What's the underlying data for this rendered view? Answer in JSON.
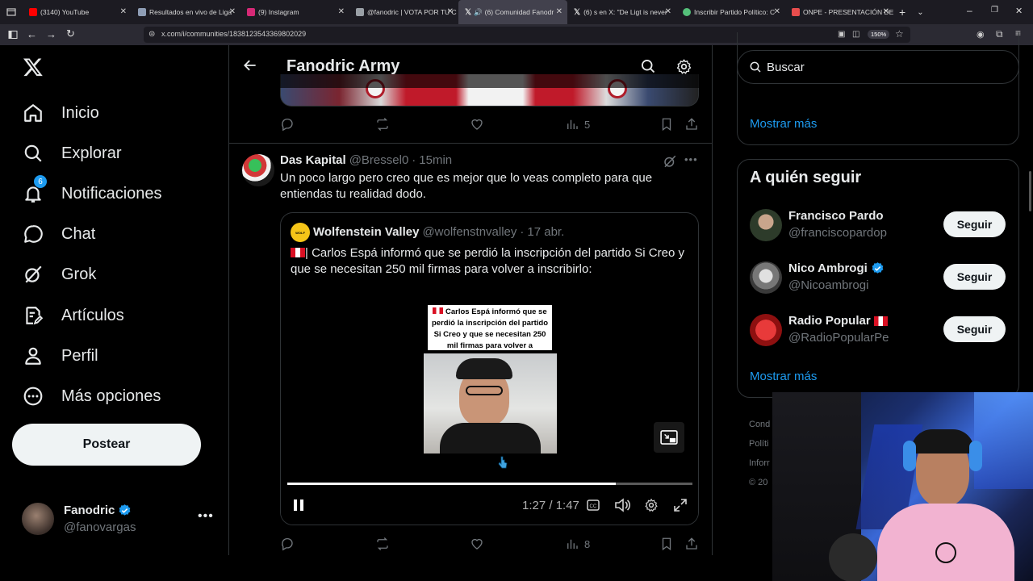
{
  "browser": {
    "tabs": [
      {
        "title": "(3140) YouTube",
        "color": "#ff0000"
      },
      {
        "title": "Resultados en vivo de Liga",
        "color": "#8e9db5"
      },
      {
        "title": "(9) Instagram",
        "color": "#d62976"
      },
      {
        "title": "@fanodric | VOTA POR TU C",
        "color": "#9aa0a6"
      },
      {
        "title": "(6) Comunidad Fanodr",
        "color": "#ffffff"
      },
      {
        "title": "(6) s en X: \"De Ligt is never",
        "color": "#ffffff"
      },
      {
        "title": "Inscribir Partido Político: C",
        "color": "#55c07a"
      },
      {
        "title": "ONPE - PRESENTACIÓN DE",
        "color": "#e84d4d"
      }
    ],
    "url": "x.com/i/communities/1838123543369802029",
    "zoom": "150%"
  },
  "nav": {
    "items": [
      {
        "label": "Inicio",
        "icon": "home-icon"
      },
      {
        "label": "Explorar",
        "icon": "search-icon"
      },
      {
        "label": "Notificaciones",
        "icon": "bell-icon"
      },
      {
        "label": "Chat",
        "icon": "chat-icon"
      },
      {
        "label": "Grok",
        "icon": "grok-icon"
      },
      {
        "label": "Artículos",
        "icon": "articles-icon"
      },
      {
        "label": "Perfil",
        "icon": "person-icon"
      },
      {
        "label": "Más opciones",
        "icon": "more-circle-icon"
      }
    ],
    "notif_count": "6",
    "post_label": "Postear"
  },
  "account": {
    "name": "Fanodric",
    "handle": "@fanovargas"
  },
  "header": {
    "title": "Fanodric Army"
  },
  "prev_post": {
    "views": "5"
  },
  "post": {
    "author": "Das Kapital",
    "handle": "@Bressel0",
    "time": "15min",
    "text": "Un poco largo pero creo que es mejor que lo veas completo para que entiendas tu realidad dodo.",
    "views": "8",
    "quote": {
      "author": "Wolfenstein Valley",
      "handle": "@wolfenstnvalley",
      "date": "17 abr.",
      "text": "| Carlos Espá informó que se perdió la inscripción del partido Si Creo y que se necesitan 250 mil firmas para volver a inscribirlo:",
      "video_caption": "Carlos Espá informó que se perdió la inscripción del partido Si Creo y que se necesitan 250 mil firmas para volver a inscribirlo:",
      "video_time": "1:27 / 1:47",
      "progress": 0.81
    }
  },
  "right": {
    "search_placeholder": "Buscar",
    "prev_show_more": "Mostrar más",
    "who_title": "A quién seguir",
    "who": [
      {
        "name": "Francisco Pardo",
        "handle": "@franciscopardop",
        "verified": false
      },
      {
        "name": "Nico Ambrogi",
        "handle": "@Nicoambrogi",
        "verified": true
      },
      {
        "name": "Radio Popular",
        "handle": "@RadioPopularPe",
        "verified": false
      }
    ],
    "follow_label": "Seguir",
    "show_more": "Mostrar más",
    "footer": [
      "Cond",
      "Políti",
      "Inforr",
      "© 20"
    ]
  },
  "colors": {
    "accent": "#1d9bf0",
    "bg": "#000000",
    "border": "#2f3336",
    "muted": "#71767b"
  }
}
